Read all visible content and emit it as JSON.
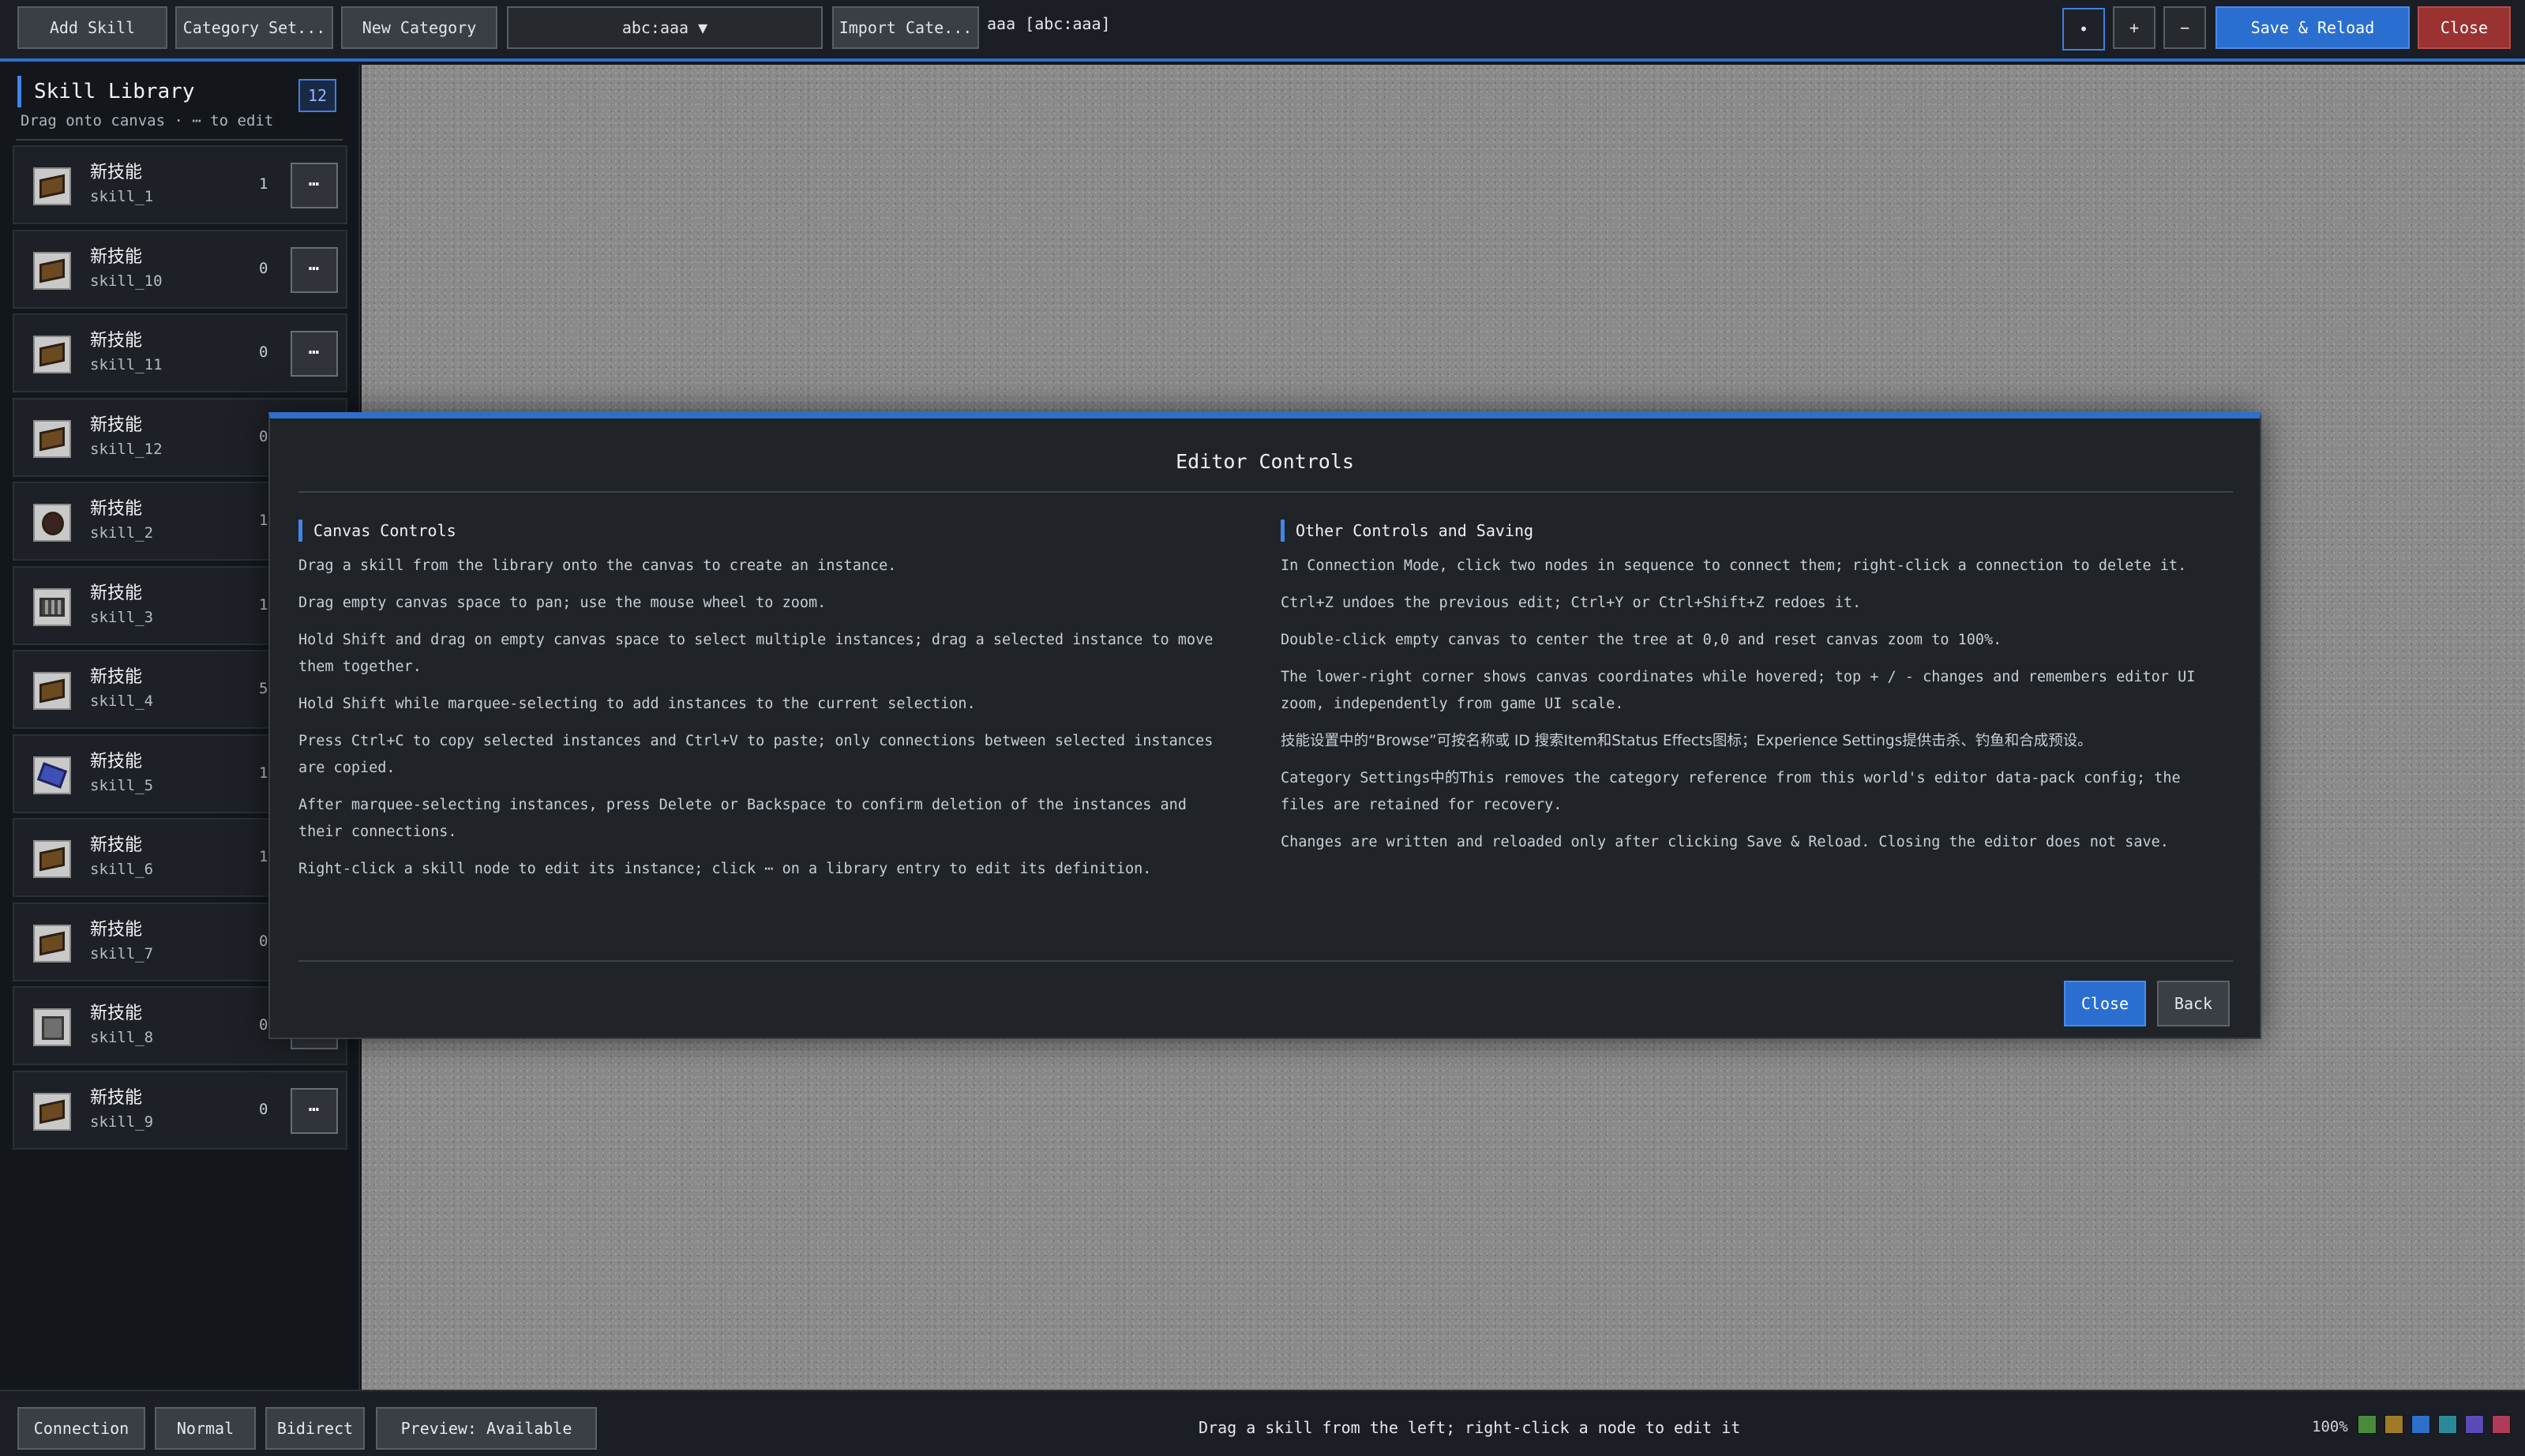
{
  "toolbar": {
    "add_skill": "Add Skill",
    "category_settings": "Category Set...",
    "new_category": "New Category",
    "namespace_select": "abc:aaa ▼",
    "import_category": "Import Cate...",
    "namespace_label": "aaa [abc:aaa]",
    "icon_btn_1": "•",
    "zoom_in": "+",
    "zoom_out": "−",
    "save_reload": "Save & Reload",
    "close": "Close"
  },
  "library": {
    "title": "Skill Library",
    "count": "12",
    "hint": "Drag onto canvas · ⋯ to edit",
    "more_label": "⋯",
    "items": [
      {
        "name": "新技能",
        "id": "skill_1",
        "count": "1",
        "icon": "book-icon"
      },
      {
        "name": "新技能",
        "id": "skill_10",
        "count": "0",
        "icon": "book-icon"
      },
      {
        "name": "新技能",
        "id": "skill_11",
        "count": "0",
        "icon": "book-icon"
      },
      {
        "name": "新技能",
        "id": "skill_12",
        "count": "0",
        "icon": "book-icon"
      },
      {
        "name": "新技能",
        "id": "skill_2",
        "count": "1",
        "icon": "orb-icon"
      },
      {
        "name": "新技能",
        "id": "skill_3",
        "count": "1",
        "icon": "cage-icon"
      },
      {
        "name": "新技能",
        "id": "skill_4",
        "count": "5",
        "icon": "book-icon"
      },
      {
        "name": "新技能",
        "id": "skill_5",
        "count": "1",
        "icon": "star-icon"
      },
      {
        "name": "新技能",
        "id": "skill_6",
        "count": "1",
        "icon": "book-icon"
      },
      {
        "name": "新技能",
        "id": "skill_7",
        "count": "0",
        "icon": "book-icon"
      },
      {
        "name": "新技能",
        "id": "skill_8",
        "count": "0",
        "icon": "block-icon"
      },
      {
        "name": "新技能",
        "id": "skill_9",
        "count": "0",
        "icon": "book-icon"
      }
    ]
  },
  "modal": {
    "title": "Editor Controls",
    "left_heading": "Canvas Controls",
    "left": [
      "Drag a skill from the library onto the canvas to create an instance.",
      "Drag empty canvas space to pan; use the mouse wheel to zoom.",
      "Hold Shift and drag on empty canvas space to select multiple instances; drag a selected instance to move them together.",
      "Hold Shift while marquee-selecting to add instances to the current selection.",
      "Press Ctrl+C to copy selected instances and Ctrl+V to paste; only connections between selected instances are copied.",
      "After marquee-selecting instances, press Delete or Backspace to confirm deletion of the instances and their connections.",
      "Right-click a skill node to edit its instance; click ⋯ on a library entry to edit its definition."
    ],
    "right_heading": "Other Controls and Saving",
    "right": [
      "In Connection Mode, click two nodes in sequence to connect them; right-click a connection to delete it.",
      "Ctrl+Z undoes the previous edit; Ctrl+Y or Ctrl+Shift+Z redoes it.",
      "Double-click empty canvas to center the tree at 0,0 and reset canvas zoom to 100%.",
      "The lower-right corner shows canvas coordinates while hovered; top + / - changes and remembers editor UI zoom, independently from game UI scale.",
      "技能设置中的“Browse”可按名称或 ID 搜索Item和Status Effects图标；Experience Settings提供击杀、钓鱼和合成预设。",
      "Category Settings中的This removes the category reference from this world's editor data-pack config; the files are retained for recovery.",
      "Changes are written and reloaded only after clicking Save & Reload. Closing the editor does not save."
    ],
    "close": "Close",
    "back": "Back"
  },
  "bottom": {
    "connection": "Connection",
    "normal": "Normal",
    "bidirect": "Bidirect",
    "preview": "Preview: Available",
    "status": "Drag a skill from the left; right-click a node to edit it",
    "zoom": "100%",
    "swatches": [
      "#4a8a3a",
      "#a07a28",
      "#2f6fcc",
      "#2a8a9a",
      "#5a4ab8",
      "#b03a5a"
    ]
  },
  "colors": {
    "accent": "#2f6fcc",
    "danger": "#9a3232"
  }
}
